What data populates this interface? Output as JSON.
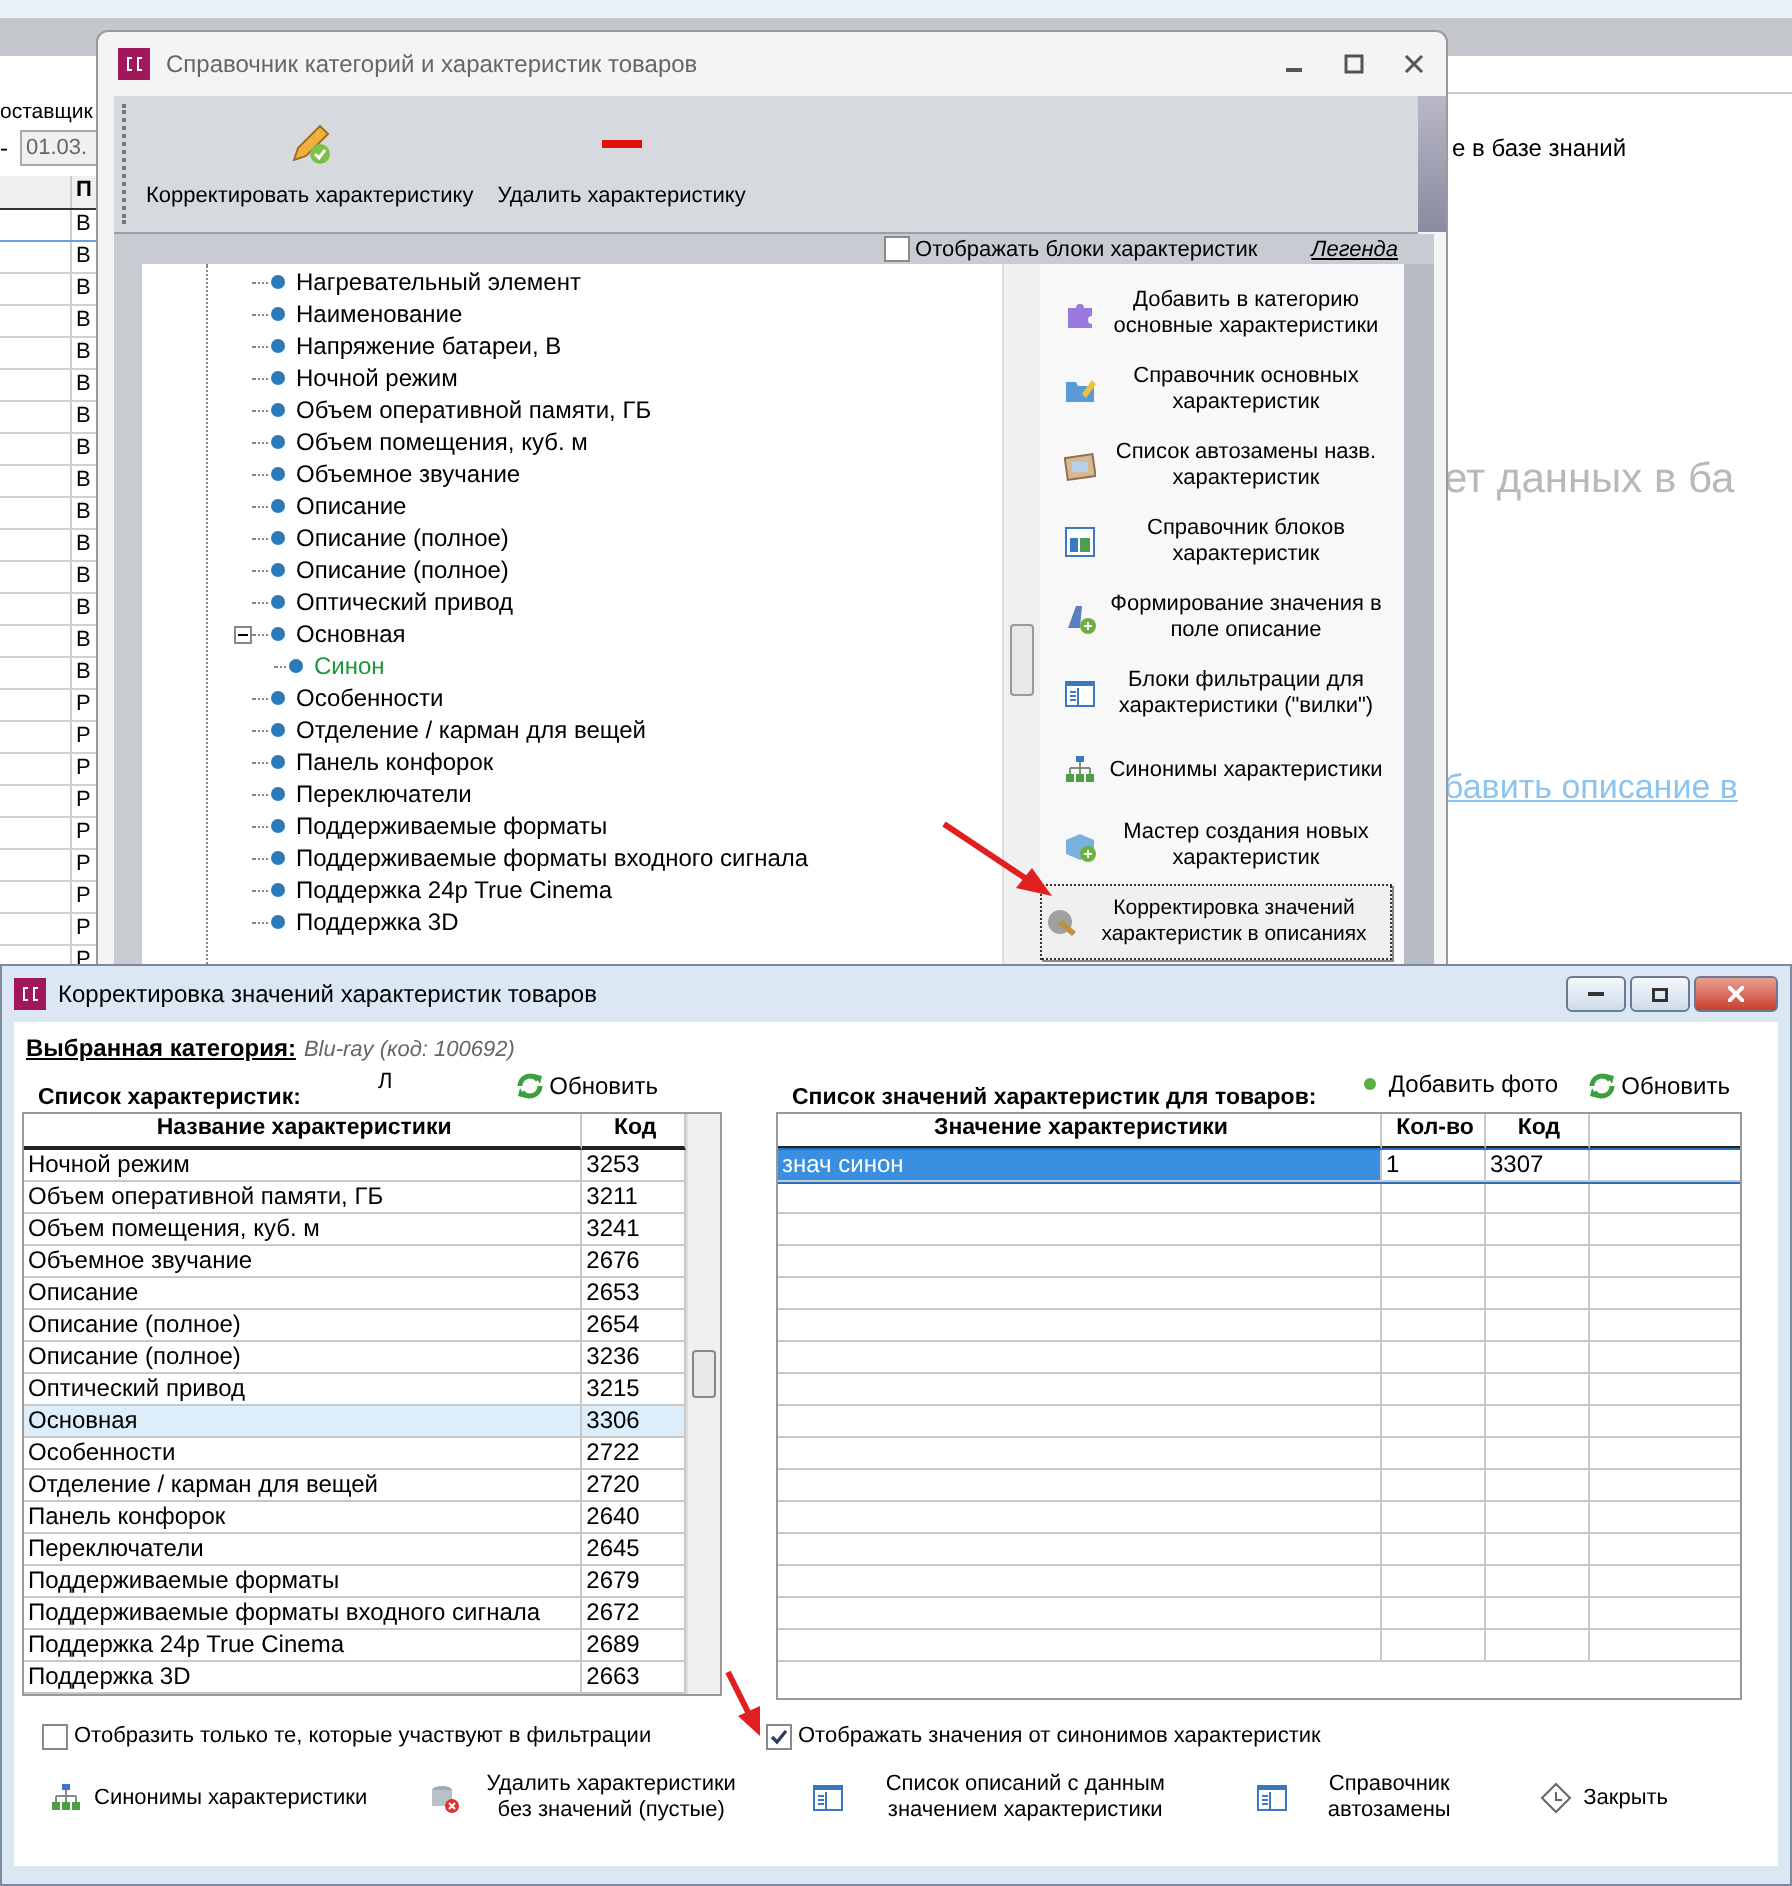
{
  "background_window": {
    "supplier_label": "оставщик",
    "range_dash": "-",
    "date_field": "01.03.",
    "column_header": "П",
    "rows": [
      "B",
      "B",
      "B",
      "B",
      "B",
      "B",
      "B",
      "B",
      "B",
      "B",
      "B",
      "B",
      "B",
      "B",
      "B",
      "P",
      "P",
      "P",
      "P",
      "P",
      "P",
      "P",
      "P",
      "P"
    ],
    "info_text": "е в базе знаний",
    "empty_message": "ет данных в ба",
    "add_link": "бавить описание в"
  },
  "catalog_window": {
    "title": "Справочник категорий и характеристик товаров",
    "toolbar": [
      {
        "label": "Корректировать характеристику",
        "kind": "edit"
      },
      {
        "label": "Удалить характеристику",
        "kind": "delete"
      }
    ],
    "show_blocks": {
      "label": "Отображать блоки характеристик",
      "checked": false
    },
    "legend_link": "Легенда",
    "tree": [
      {
        "label": "Нагревательный элемент"
      },
      {
        "label": "Наименование"
      },
      {
        "label": "Напряжение батареи, В"
      },
      {
        "label": "Ночной режим"
      },
      {
        "label": "Объем оперативной памяти, ГБ"
      },
      {
        "label": "Объем помещения, куб. м"
      },
      {
        "label": "Объемное звучание"
      },
      {
        "label": "Описание"
      },
      {
        "label": "Описание (полное)"
      },
      {
        "label": "Описание (полное)"
      },
      {
        "label": "Оптический привод"
      },
      {
        "label": "Основная",
        "expanded": true,
        "children": [
          {
            "label": "Синон",
            "kind": "synonym"
          }
        ]
      },
      {
        "label": "Особенности"
      },
      {
        "label": "Отделение / карман для вещей"
      },
      {
        "label": "Панель конфорок"
      },
      {
        "label": "Переключатели"
      },
      {
        "label": "Поддерживаемые форматы"
      },
      {
        "label": "Поддерживаемые форматы входного сигнала"
      },
      {
        "label": "Поддержка 24p True Cinema"
      },
      {
        "label": "Поддержка 3D"
      }
    ],
    "actions": [
      {
        "label": "Добавить в категорию основные характеристики",
        "kind": "puzzle",
        "focused": false
      },
      {
        "label": "Справочник основных характеристик",
        "kind": "folder",
        "focused": false
      },
      {
        "label": "Список автозамены назв. характеристик",
        "kind": "note",
        "focused": false
      },
      {
        "label": "Справочник блоков характеристик",
        "kind": "blocks",
        "focused": false
      },
      {
        "label": "Формирование значения в поле описание",
        "kind": "formula",
        "focused": false
      },
      {
        "label": "Блоки фильтрации для характеристики (\"вилки\")",
        "kind": "list",
        "focused": false
      },
      {
        "label": "Синонимы характеристики",
        "kind": "hierarchy",
        "focused": false
      },
      {
        "label": "Мастер создания новых характеристик",
        "kind": "wizard",
        "focused": false
      },
      {
        "label": "Корректировка значений характеристик в описаниях",
        "kind": "correct",
        "focused": true
      }
    ]
  },
  "values_window": {
    "title": "Корректировка значений характеристик товаров",
    "category_label": "Выбранная категория:",
    "category_value": "Blu-ray (код: 100692)",
    "list_title": "Список характеристик:",
    "stray_mark": "Л",
    "refresh_left": "Обновить",
    "columns": [
      "Название характеристики",
      "Код"
    ],
    "rows": [
      {
        "name": "Ночной режим",
        "code": "3253",
        "selected": false
      },
      {
        "name": "Объем оперативной памяти, ГБ",
        "code": "3211",
        "selected": false
      },
      {
        "name": "Объем помещения, куб. м",
        "code": "3241",
        "selected": false
      },
      {
        "name": "Объемное звучание",
        "code": "2676",
        "selected": false
      },
      {
        "name": "Описание",
        "code": "2653",
        "selected": false
      },
      {
        "name": "Описание (полное)",
        "code": "2654",
        "selected": false
      },
      {
        "name": "Описание (полное)",
        "code": "3236",
        "selected": false
      },
      {
        "name": "Оптический привод",
        "code": "3215",
        "selected": false
      },
      {
        "name": "Основная",
        "code": "3306",
        "selected": true
      },
      {
        "name": "Особенности",
        "code": "2722",
        "selected": false
      },
      {
        "name": "Отделение / карман для вещей",
        "code": "2720",
        "selected": false
      },
      {
        "name": "Панель конфорок",
        "code": "2640",
        "selected": false
      },
      {
        "name": "Переключатели",
        "code": "2645",
        "selected": false
      },
      {
        "name": "Поддерживаемые форматы",
        "code": "2679",
        "selected": false
      },
      {
        "name": "Поддерживаемые форматы входного сигнала",
        "code": "2672",
        "selected": false
      },
      {
        "name": "Поддержка 24p True Cinema",
        "code": "2689",
        "selected": false
      },
      {
        "name": "Поддержка 3D",
        "code": "2663",
        "selected": false
      }
    ],
    "values_title": "Список значений характеристик для товаров:",
    "add_photo": "Добавить фото",
    "refresh_right": "Обновить",
    "value_columns": [
      "Значение характеристики",
      "Кол-во",
      "Код"
    ],
    "value_rows": [
      {
        "value": "знач синон",
        "count": "1",
        "code": "3307",
        "selected": true
      }
    ],
    "filter_only": {
      "label": "Отобразить только те, которые участвуют в фильтрации",
      "checked": false
    },
    "show_synonyms": {
      "label": "Отображать значения от синонимов характеристик",
      "checked": true
    },
    "buttons": [
      {
        "label": "Синонимы характеристики",
        "kind": "hierarchy"
      },
      {
        "label": "Удалить характеристики без значений (пустые)",
        "kind": "delete-empty"
      },
      {
        "label": "Список описаний с данным значением характеристики",
        "kind": "list"
      },
      {
        "label": "Справочник автозамены",
        "kind": "list"
      },
      {
        "label": "Закрыть",
        "kind": "close"
      }
    ]
  }
}
